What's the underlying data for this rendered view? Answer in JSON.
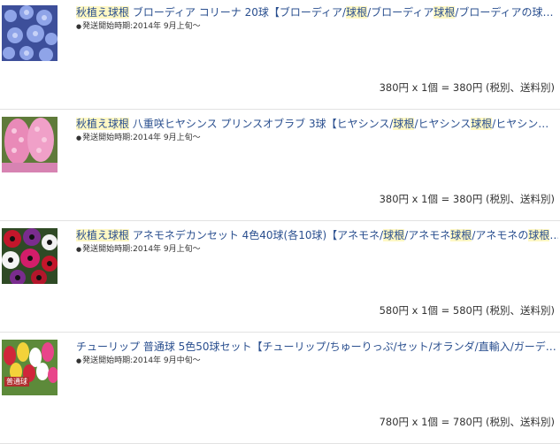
{
  "items": [
    {
      "image": "blue-brodiaea-flowers",
      "title": [
        {
          "text": "秋植え球根",
          "hl": true
        },
        {
          "text": " ブローディア コリーナ 20球【ブローディア/",
          "hl": false
        },
        {
          "text": "球根",
          "hl": true
        },
        {
          "text": "/ブローディア",
          "hl": false
        },
        {
          "text": "球根",
          "hl": true
        },
        {
          "text": "/ブローディアの球…",
          "hl": false
        }
      ],
      "ship": "発送開始時期:2014年 9月上旬〜",
      "price": "380円 x 1個 = 380円 (税別、送料別)"
    },
    {
      "image": "pink-hyacinth-flowers",
      "title": [
        {
          "text": "秋植え球根",
          "hl": true
        },
        {
          "text": " 八重咲ヒヤシンス プリンスオブラブ 3球【ヒヤシンス/",
          "hl": false
        },
        {
          "text": "球根",
          "hl": true
        },
        {
          "text": "/ヒヤシンス",
          "hl": false
        },
        {
          "text": "球根",
          "hl": true
        },
        {
          "text": "/ヒヤシン…",
          "hl": false
        }
      ],
      "ship": "発送開始時期:2014年 9月上旬〜",
      "price": "380円 x 1個 = 380円 (税別、送料別)"
    },
    {
      "image": "mixed-anemone-flowers",
      "title": [
        {
          "text": "秋植え球根",
          "hl": true
        },
        {
          "text": " アネモネデカンセット 4色40球(各10球)【アネモネ/",
          "hl": false
        },
        {
          "text": "球根",
          "hl": true
        },
        {
          "text": "/アネモネ",
          "hl": false
        },
        {
          "text": "球根",
          "hl": true
        },
        {
          "text": "/アネモネの",
          "hl": false
        },
        {
          "text": "球根",
          "hl": true
        },
        {
          "text": "…",
          "hl": false
        }
      ],
      "ship": "発送開始時期:2014年 9月上旬〜",
      "price": "580円 x 1個 = 580円 (税別、送料別)"
    },
    {
      "image": "mixed-tulip-flowers",
      "badge": "普通球",
      "title": [
        {
          "text": "チューリップ 普通球 5色50球セット【チューリップ/ちゅーりっぷ/セット/オランダ/直輸入/ガーデ…",
          "hl": false
        }
      ],
      "ship": "発送開始時期:2014年 9月中旬〜",
      "price": "780円 x 1個 = 780円 (税別、送料別)"
    }
  ]
}
